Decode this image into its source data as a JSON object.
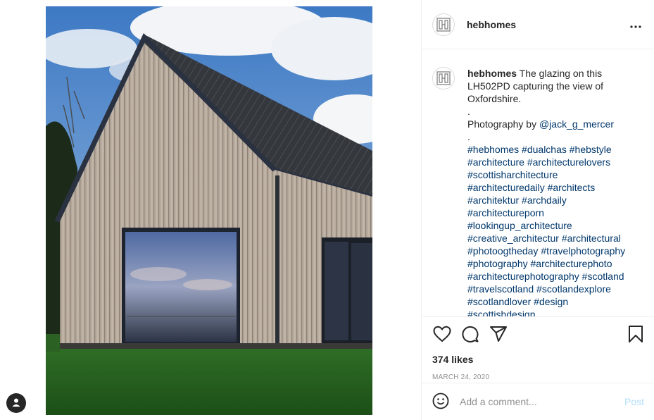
{
  "post": {
    "username": "hebhomes",
    "caption_lines": [
      "The glazing on this",
      "LH502PD capturing the view of",
      "Oxfordshire.",
      ".",
      "Photography by"
    ],
    "photographer_handle": "@jack_g_mercer",
    "caption_dot": ".",
    "hashtag_lines": [
      "#hebhomes #dualchas #hebstyle",
      "#architecture #architecturelovers",
      "#scottisharchitecture",
      "#architecturedaily #architects",
      "#architektur #archdaily",
      "#architectureporn",
      "#lookingup_architecture",
      "#creative_architectur #architectural",
      "#photoogtheday #travelphotography",
      "#photography #architecturephoto",
      "#architecturephotography #scotland",
      "#travelscotland #scotlandexplore",
      "#scotlandlover #design",
      "#scottishdesign"
    ],
    "likes_text": "374 likes",
    "date": "MARCH 24, 2020"
  },
  "comment_box": {
    "placeholder": "Add a comment...",
    "post_label": "Post"
  },
  "icons": {
    "like": "heart-icon",
    "comment": "speech-bubble-icon",
    "share": "paper-plane-icon",
    "save": "bookmark-icon",
    "more": "more-options-icon",
    "emoji": "emoji-icon",
    "profile": "user-silhouette-icon"
  },
  "colors": {
    "link": "#00376b",
    "post_disabled": "#b2dffc",
    "muted": "#8e8e8e",
    "text": "#262626"
  }
}
